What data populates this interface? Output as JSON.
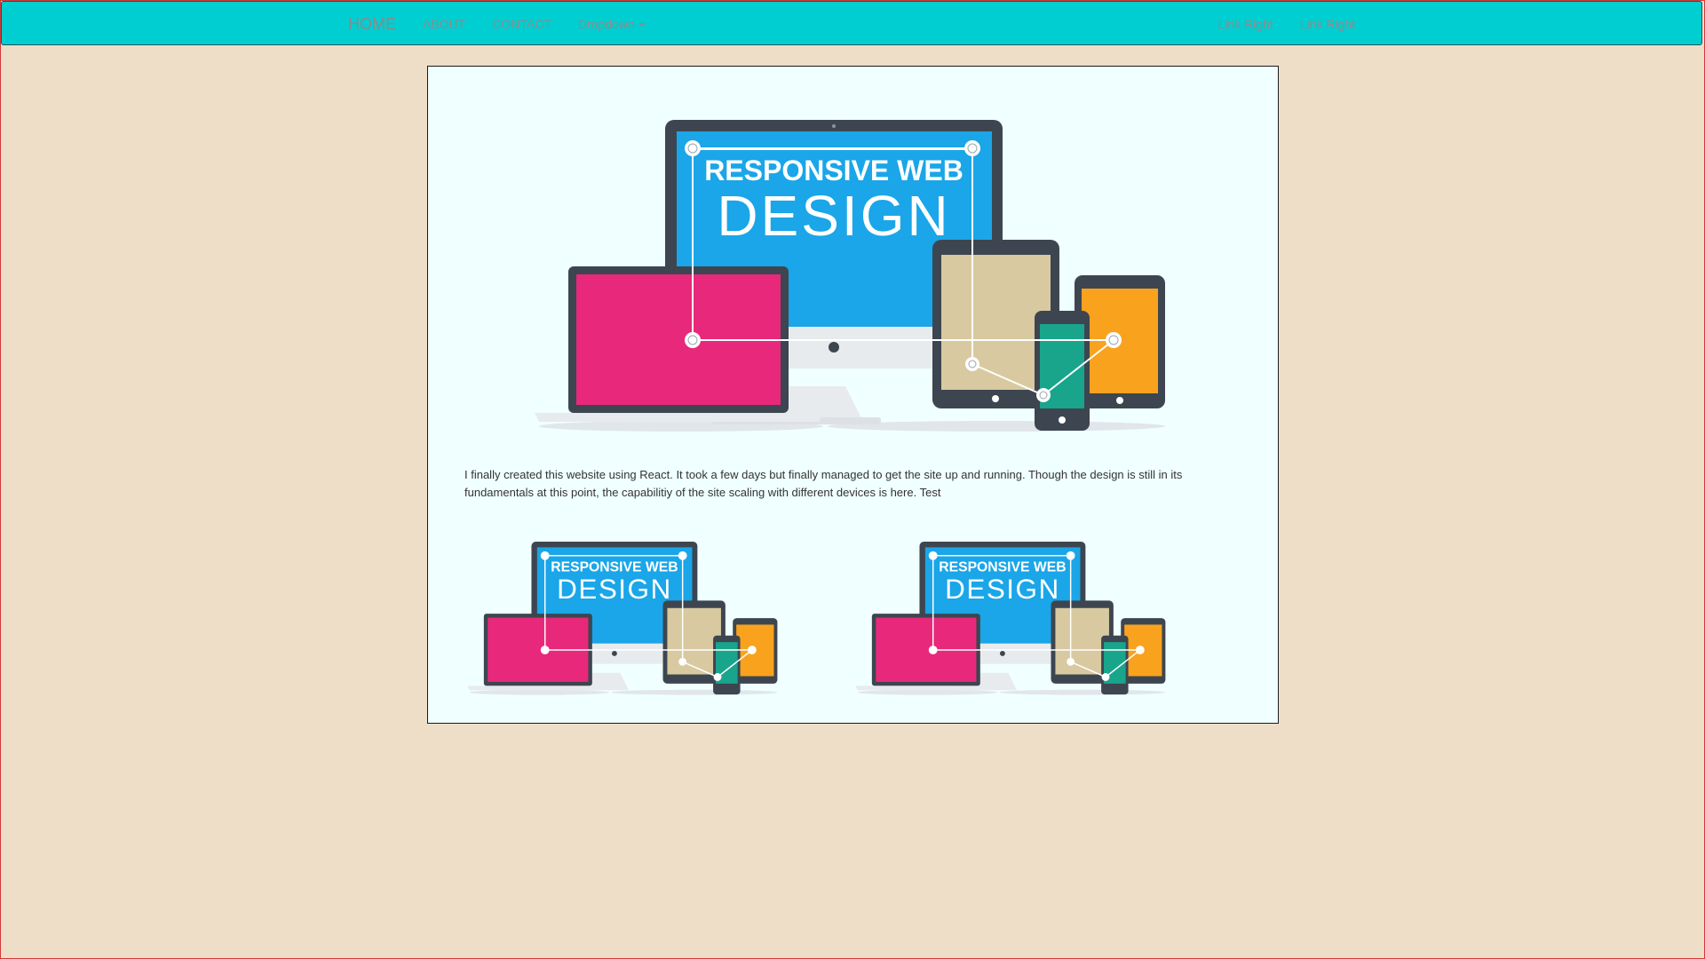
{
  "navbar": {
    "brand": "HOME",
    "links_left": [
      "ABOUT",
      "CONTACT"
    ],
    "dropdown_label": "Dropdown",
    "links_right": [
      "Link Right",
      "Link Right"
    ]
  },
  "hero_image": {
    "line1": "RESPONSIVE WEB",
    "line2": "DESIGN"
  },
  "content": {
    "paragraph": "I finally created this website using React. It took a few days but finally managed to get the site up and running. Though the design is still in its fundamentals at this point, the capabilitiy of the site scaling with different devices is here. Test"
  },
  "thumbnails": [
    {
      "line1": "RESPONSIVE WEB",
      "line2": "DESIGN"
    },
    {
      "line1": "RESPONSIVE WEB",
      "line2": "DESIGN"
    }
  ],
  "colors": {
    "navbar_bg": "#00ced1",
    "page_bg": "#eedec8",
    "card_bg": "#f0ffff",
    "monitor_screen": "#1aa6e8",
    "laptop_screen": "#e8287a",
    "tablet_screen": "#d8c9a0",
    "phone_screen": "#18a58c",
    "tablet2_screen": "#f9a21e",
    "device_frame": "#3d4650"
  }
}
